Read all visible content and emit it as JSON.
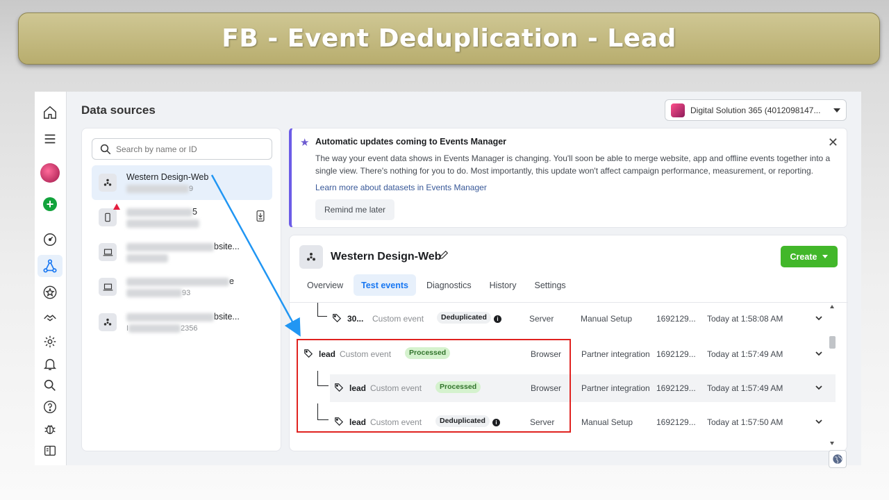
{
  "banner": {
    "title": "FB - Event Deduplication - Lead"
  },
  "page": {
    "title": "Data sources"
  },
  "account": {
    "name": "Digital Solution 365 (4012098147..."
  },
  "search": {
    "placeholder": "Search by name or ID"
  },
  "sources": [
    {
      "name": "Western Design-Web",
      "id_suffix": "9",
      "icon": "pixel-icon",
      "selected": true
    },
    {
      "name_suffix": "5",
      "icon": "mobile-icon",
      "warning": true
    },
    {
      "name_suffix": "bsite...",
      "icon": "laptop-icon"
    },
    {
      "name_suffix": "e",
      "id_suffix": "93",
      "icon": "laptop-icon"
    },
    {
      "name_suffix": "bsite...",
      "id_prefix": "I",
      "id_suffix": "2356",
      "icon": "pixel-icon"
    }
  ],
  "notice": {
    "title": "Automatic updates coming to Events Manager",
    "body": "The way your event data shows in Events Manager is changing. You'll soon be able to merge website, app and offline events together into a single view. There's nothing for you to do. Most importantly, this update won't affect campaign performance, measurement, or reporting.",
    "link": "Learn more about datasets in Events Manager",
    "button": "Remind me later"
  },
  "dataset": {
    "name": "Western Design-Web",
    "create_label": "Create",
    "tabs": [
      "Overview",
      "Test events",
      "Diagnostics",
      "History",
      "Settings"
    ],
    "active_tab": "Test events"
  },
  "events": [
    {
      "name": "30...",
      "type": "Custom event",
      "status": "Deduplicated",
      "source": "Server",
      "setup": "Manual Setup",
      "id": "1692129...",
      "time": "Today at 1:58:08 AM",
      "child": true
    },
    {
      "name": "lead",
      "type": "Custom event",
      "status": "Processed",
      "source": "Browser",
      "setup": "Partner integration",
      "id": "1692129...",
      "time": "Today at 1:57:49 AM",
      "child": false
    },
    {
      "name": "lead",
      "type": "Custom event",
      "status": "Processed",
      "source": "Browser",
      "setup": "Partner integration",
      "id": "1692129...",
      "time": "Today at 1:57:49 AM",
      "child": true
    },
    {
      "name": "lead",
      "type": "Custom event",
      "status": "Deduplicated",
      "source": "Server",
      "setup": "Manual Setup",
      "id": "1692129...",
      "time": "Today at 1:57:50 AM",
      "child": true
    }
  ],
  "colors": {
    "accent": "#1877f2",
    "create": "#42b72a",
    "highlight": "#e0221f",
    "banner": "#c4bb80",
    "arrow": "#2196f3"
  }
}
